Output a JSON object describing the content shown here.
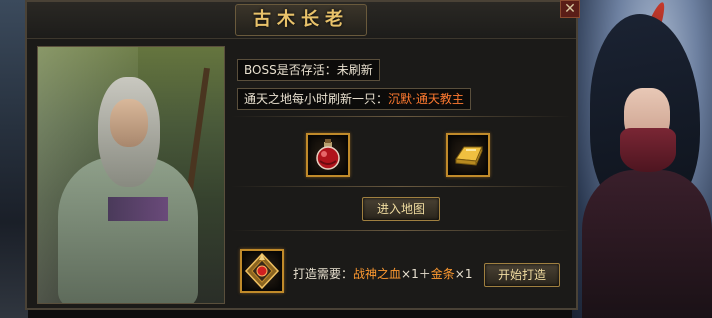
{
  "window": {
    "title": "古木长老",
    "close_icon": "close-icon"
  },
  "info": {
    "boss_label": "BOSS是否存活：",
    "boss_value": "未刷新",
    "refresh_label": "通天之地每小时刷新一只：",
    "refresh_value": "沉默·通天教主"
  },
  "rewards": [
    {
      "icon": "red-potion-icon"
    },
    {
      "icon": "gold-bar-icon"
    }
  ],
  "actions": {
    "enter_map": "进入地图",
    "start_forge": "开始打造"
  },
  "forge": {
    "label": "打造需要：",
    "item1": "战神之血",
    "qty1": "×1",
    "plus": "＋",
    "item2": "金条",
    "qty2": "×1",
    "icon": "war-crest-icon"
  },
  "colors": {
    "title_gold": "#e8c26a",
    "highlight_orange": "#ff7a30",
    "frame_gold": "#c08a2a"
  }
}
